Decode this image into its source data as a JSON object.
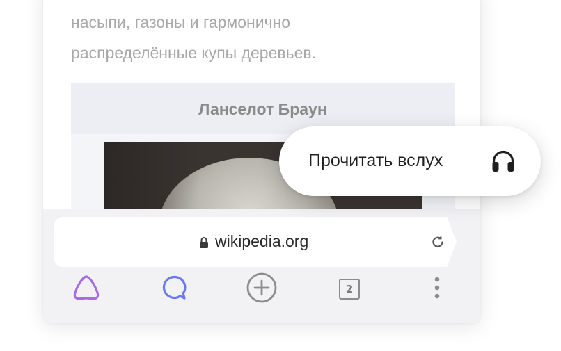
{
  "article": {
    "lines": [
      "насыпи, газоны и гармонично",
      "распределённые купы деревьев."
    ],
    "infobox_title": "Ланселот Браун"
  },
  "address_bar": {
    "url": "wikipedia.org",
    "lock_icon": "lock-icon",
    "reload_icon": "reload-icon"
  },
  "bottom_nav": {
    "items": [
      {
        "icon": "alice-icon",
        "color": "#a46be4"
      },
      {
        "icon": "chat-bubble-icon",
        "color": "#6a79ee"
      },
      {
        "icon": "plus-circle-icon",
        "color": "#8c8c8c"
      },
      {
        "icon": "tabs-icon",
        "count": "2",
        "color": "#8c8c8c"
      },
      {
        "icon": "more-vertical-icon",
        "color": "#8c8c8c"
      }
    ]
  },
  "popup": {
    "label": "Прочитать вслух",
    "icon": "headphones-icon"
  },
  "colors": {
    "article_text": "#a8a8a8",
    "infobox_bg": "#f4f5f8",
    "toolbar_bg": "#f2f2f5",
    "alice_purple": "#a46be4",
    "messenger_blue": "#6a79ee"
  }
}
